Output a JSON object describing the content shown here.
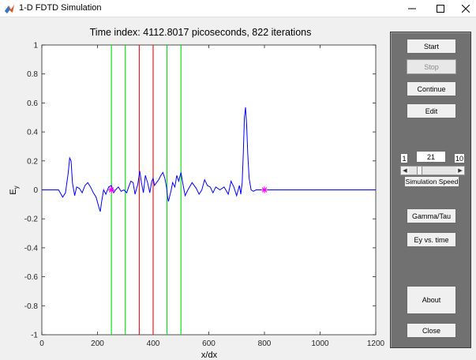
{
  "window": {
    "title": "1-D FDTD Simulation",
    "minimize_icon": "minimize-icon",
    "maximize_icon": "maximize-icon",
    "close_icon": "close-icon",
    "app_icon": "matlab-icon"
  },
  "plot": {
    "title": "Time index: 4112.8017 picoseconds, 822 iterations",
    "xlabel": "x/dx",
    "ylabel": "E",
    "ylabel_sub": "y"
  },
  "chart_data": {
    "type": "line",
    "title": "Time index: 4112.8017 picoseconds, 822 iterations",
    "xlabel": "x/dx",
    "ylabel": "Ey",
    "xlim": [
      0,
      1200
    ],
    "ylim": [
      -1,
      1
    ],
    "x_ticks": [
      0,
      200,
      400,
      600,
      800,
      1000,
      1200
    ],
    "y_ticks": [
      -1,
      -0.8,
      -0.6,
      -0.4,
      -0.2,
      0,
      0.2,
      0.4,
      0.6,
      0.8,
      1
    ],
    "x_tick_labels": [
      "0",
      "200",
      "400",
      "600",
      "800",
      "1000",
      "1200"
    ],
    "y_tick_labels": [
      "-1",
      "-0.8",
      "-0.6",
      "-0.4",
      "-0.2",
      "0",
      "0.2",
      "0.4",
      "0.6",
      "0.8",
      "1"
    ],
    "grid": false,
    "series": [
      {
        "color": "#0000ff",
        "x": [
          0,
          60,
          75,
          85,
          95,
          100,
          105,
          110,
          118,
          125,
          135,
          145,
          155,
          165,
          175,
          185,
          195,
          205,
          210,
          215,
          222,
          230,
          240,
          250,
          258,
          265,
          275,
          285,
          295,
          305,
          312,
          320,
          328,
          335,
          345,
          352,
          358,
          365,
          372,
          380,
          388,
          395,
          400,
          405,
          412,
          420,
          428,
          435,
          442,
          448,
          452,
          455,
          460,
          465,
          470,
          478,
          485,
          492,
          500,
          508,
          515,
          525,
          540,
          555,
          565,
          575,
          585,
          595,
          605,
          615,
          625,
          640,
          655,
          670,
          680,
          690,
          700,
          710,
          715,
          720,
          724,
          728,
          732,
          736,
          740,
          745,
          752,
          760,
          770,
          790,
          820,
          900,
          1000,
          1200
        ],
        "y": [
          0,
          0,
          -0.05,
          -0.02,
          0.12,
          0.22,
          0.2,
          0.05,
          -0.04,
          0.02,
          0.01,
          -0.02,
          0.03,
          0.05,
          0.02,
          -0.02,
          -0.05,
          -0.12,
          -0.15,
          -0.08,
          0.0,
          -0.03,
          0.02,
          0.03,
          -0.02,
          0.0,
          0.02,
          -0.01,
          0.0,
          -0.02,
          0.02,
          0.06,
          0.05,
          -0.03,
          0.04,
          0.13,
          0.05,
          -0.02,
          0.1,
          0.05,
          -0.02,
          0.06,
          0.08,
          0.03,
          0.05,
          0.07,
          0.1,
          0.12,
          0.08,
          0.02,
          -0.05,
          -0.08,
          -0.04,
          0.0,
          0.05,
          0.02,
          0.1,
          0.06,
          0.12,
          0.03,
          -0.04,
          0.0,
          0.05,
          0.01,
          -0.03,
          0.0,
          0.07,
          0.03,
          0.02,
          -0.02,
          0.02,
          0.0,
          0.02,
          -0.03,
          0.06,
          0.02,
          -0.04,
          0.03,
          -0.03,
          0.05,
          0.25,
          0.5,
          0.57,
          0.45,
          0.25,
          0.08,
          0.0,
          -0.01,
          0.0,
          0.0,
          0.0,
          0.0,
          0.0,
          0.0
        ]
      }
    ],
    "vertical_lines": [
      {
        "x": 250,
        "color": "#00dd00"
      },
      {
        "x": 300,
        "color": "#00dd00"
      },
      {
        "x": 350,
        "color": "#ff0000"
      },
      {
        "x": 400,
        "color": "#ff0000"
      },
      {
        "x": 450,
        "color": "#00dd00"
      },
      {
        "x": 500,
        "color": "#00dd00"
      }
    ],
    "markers": [
      {
        "x": 250,
        "y": 0,
        "color": "#ff00ff",
        "symbol": "asterisk"
      },
      {
        "x": 800,
        "y": 0,
        "color": "#ff00ff",
        "symbol": "asterisk"
      }
    ]
  },
  "panel": {
    "start": "Start",
    "stop": "Stop",
    "continue": "Continue",
    "edit": "Edit",
    "speed_min": "1",
    "speed_value": "21",
    "speed_max": "10",
    "speed_label": "Simulation Speed",
    "speed_fraction": 0.18,
    "gamma_tau": "Gamma/Tau",
    "ey_vs_time": "Ey vs. time",
    "about": "About",
    "close": "Close"
  }
}
